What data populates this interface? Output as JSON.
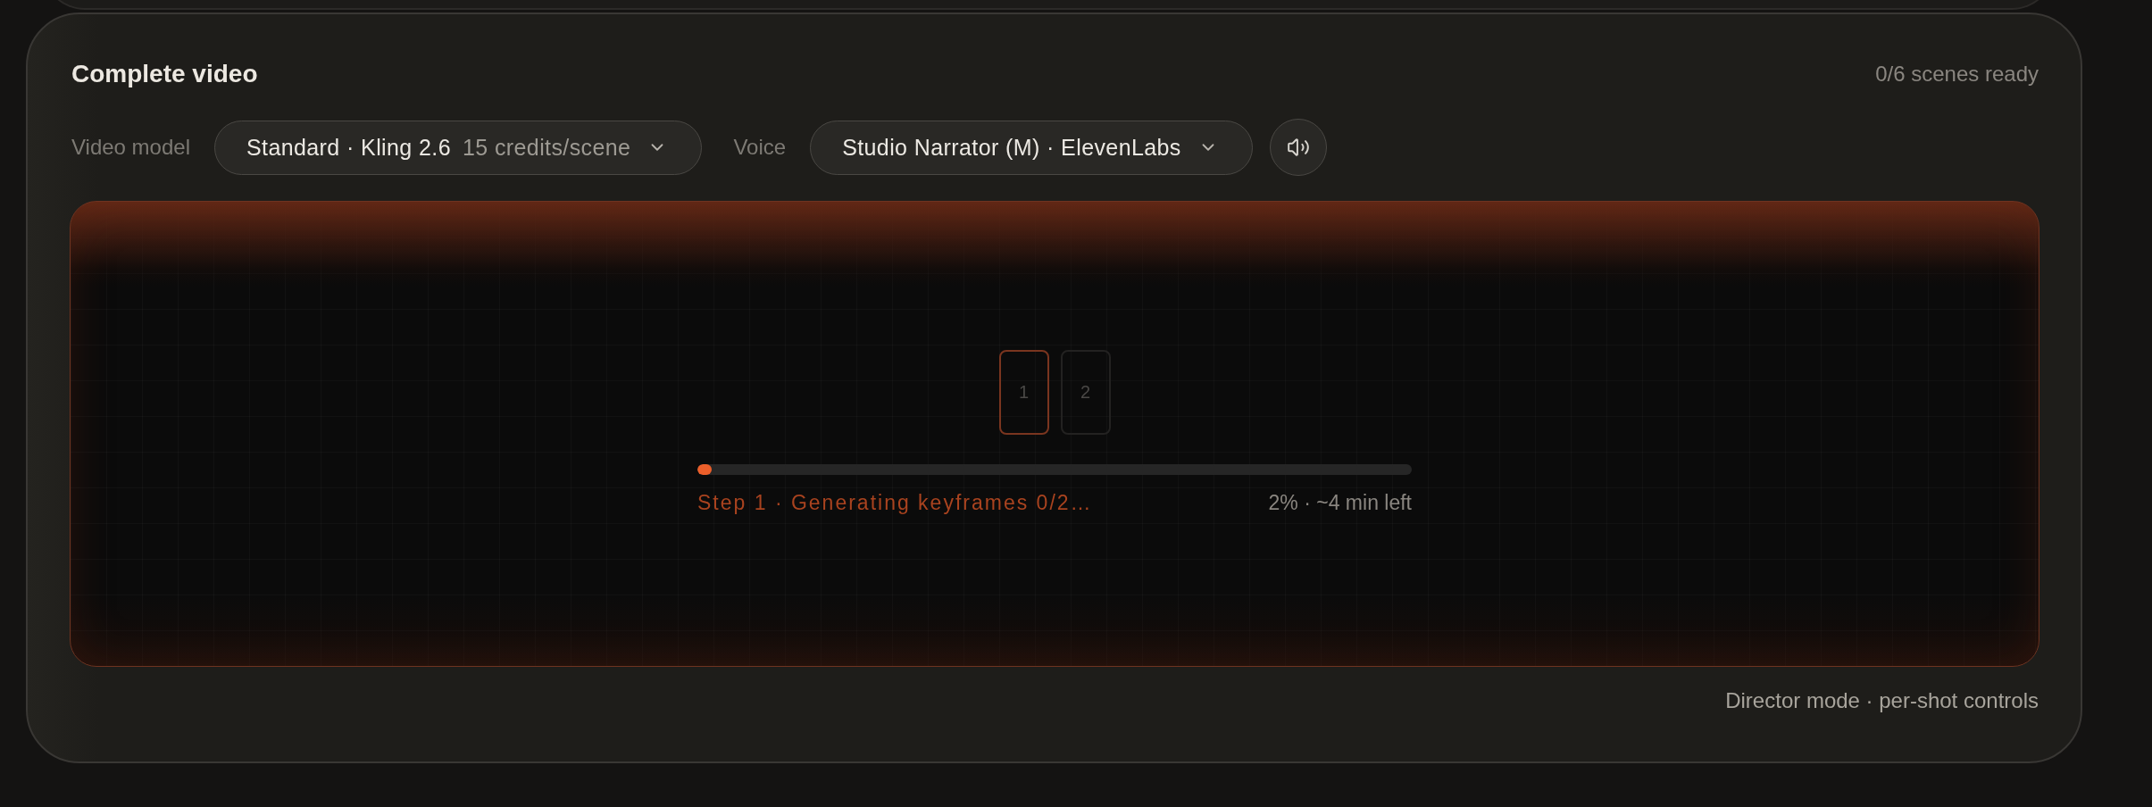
{
  "card": {
    "title": "Complete video",
    "status": "0/6 scenes ready"
  },
  "controls": [
    {
      "kind": "dropdown",
      "label": "Video model",
      "value": "Standard · Kling 2.6",
      "note": "15 credits/scene"
    },
    {
      "kind": "dropdown",
      "label": "Voice",
      "value": "Studio Narrator (M) · ElevenLabs"
    }
  ],
  "preview": {
    "keyframes": [
      {
        "label": "1",
        "active": true
      },
      {
        "label": "2",
        "active": false
      }
    ],
    "progress": {
      "level": 0.02,
      "step": "Step 1 · Generating keyframes 0/2…",
      "reading": "2% · ~4 min left"
    }
  },
  "footer": "Director mode · per-shot controls"
}
